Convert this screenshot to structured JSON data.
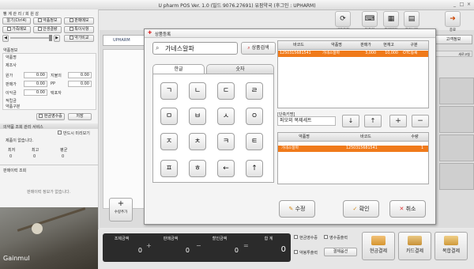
{
  "window": {
    "title": "U pharm POS Ver. 1.0 (빌드 9076.27691) 유팜약국 (후그인 : UPHARM)",
    "minimize": "_",
    "maximize": "□",
    "close": "×"
  },
  "left": {
    "section1_title": "빵 계 관 리 / 회 원 감",
    "buttons_row1": [
      "알기(Ctrl4)",
      "약품정보",
      "판매메모"
    ],
    "buttons_row2": [
      "가족메모",
      "안생결량",
      "특이사항"
    ],
    "buttons_row3_right": "약가비교",
    "section2_title": "약품정보",
    "labels_a": [
      "약품명",
      "제조사",
      "원가",
      "판매가",
      "이익금",
      "적립금",
      "약품구분"
    ],
    "values_a": [
      "0.00",
      "0.00",
      "0.00"
    ],
    "labels_b": [
      "지불의",
      "PP",
      "택포자"
    ],
    "values_b": [
      "0.00",
      "0.00"
    ],
    "btn_register": "현금영수증",
    "btn_save": "저장",
    "section3_title": "의약품 조회 관리 서비스",
    "checkbox_all": "반드시 미리보기",
    "empty_msg": "제품이 없습니다.",
    "stat_labels": [
      "최저",
      "최고",
      "평균"
    ],
    "stat_values": [
      "0",
      "0",
      "0"
    ],
    "section4_title": "판매이력 조회",
    "history_empty": "판매이력 정보가 없습니다.",
    "brand": "Gainmul"
  },
  "toolbar": {
    "items": [
      {
        "icon": "⟳",
        "label": "새로고침"
      },
      {
        "icon": "⌨",
        "label": "단축키"
      },
      {
        "icon": "▦",
        "label": "판매대장"
      },
      {
        "icon": "▤",
        "label": "환경설정"
      },
      {
        "icon": "➜",
        "label": "종료"
      }
    ],
    "prescription_tab": "고객정보",
    "refresh_small": "새로고침"
  },
  "main": {
    "logo": "UPHARM",
    "add_btn": "수량추가",
    "add_icon": "+"
  },
  "modal": {
    "title": "상품등록",
    "search_value": "가네스알파",
    "search_btn": "상품검색",
    "tabs": [
      "한글",
      "숫자"
    ],
    "keys": [
      "ㄱ",
      "ㄴ",
      "ㄷ",
      "ㄹ",
      "ㅁ",
      "ㅂ",
      "ㅅ",
      "ㅇ",
      "ㅈ",
      "ㅊ",
      "ㅋ",
      "ㅌ",
      "ㅍ",
      "ㅎ",
      "←",
      "↑"
    ],
    "table1": {
      "headers": [
        "바코드",
        "약품명",
        "판매가",
        "현재고",
        "구분"
      ],
      "row": [
        "1250315681541",
        "가네스알파",
        "3,000",
        "10,000",
        "OTC등록"
      ]
    },
    "barcode_label": "[단축키명]",
    "barcode_value": "퍼모외 복제세트",
    "nav_btns": [
      "↓",
      "↑",
      "+",
      "−"
    ],
    "table2": {
      "headers": [
        "약품명",
        "바코드",
        "수량"
      ],
      "row": [
        "가네스알파",
        "1250315681541",
        "1"
      ]
    },
    "actions": [
      {
        "icon": "✎",
        "label": "수정"
      },
      {
        "icon": "✓",
        "label": "확인"
      },
      {
        "icon": "✕",
        "label": "취소"
      }
    ]
  },
  "summary": {
    "labels": [
      "조제금액",
      "판매금액",
      "할인금액",
      "합 계"
    ],
    "values": [
      "0",
      "0",
      "0",
      "0"
    ],
    "ops": [
      "+",
      "−",
      "="
    ],
    "options": [
      "현금영수증",
      "영수증출력",
      "약봉투출력",
      "결제옵션"
    ],
    "pay_buttons": [
      "현금결제",
      "카드결제",
      "복합결제"
    ]
  },
  "colors": {
    "accent": "#f07a1a",
    "dark": "#2b2b2b"
  }
}
